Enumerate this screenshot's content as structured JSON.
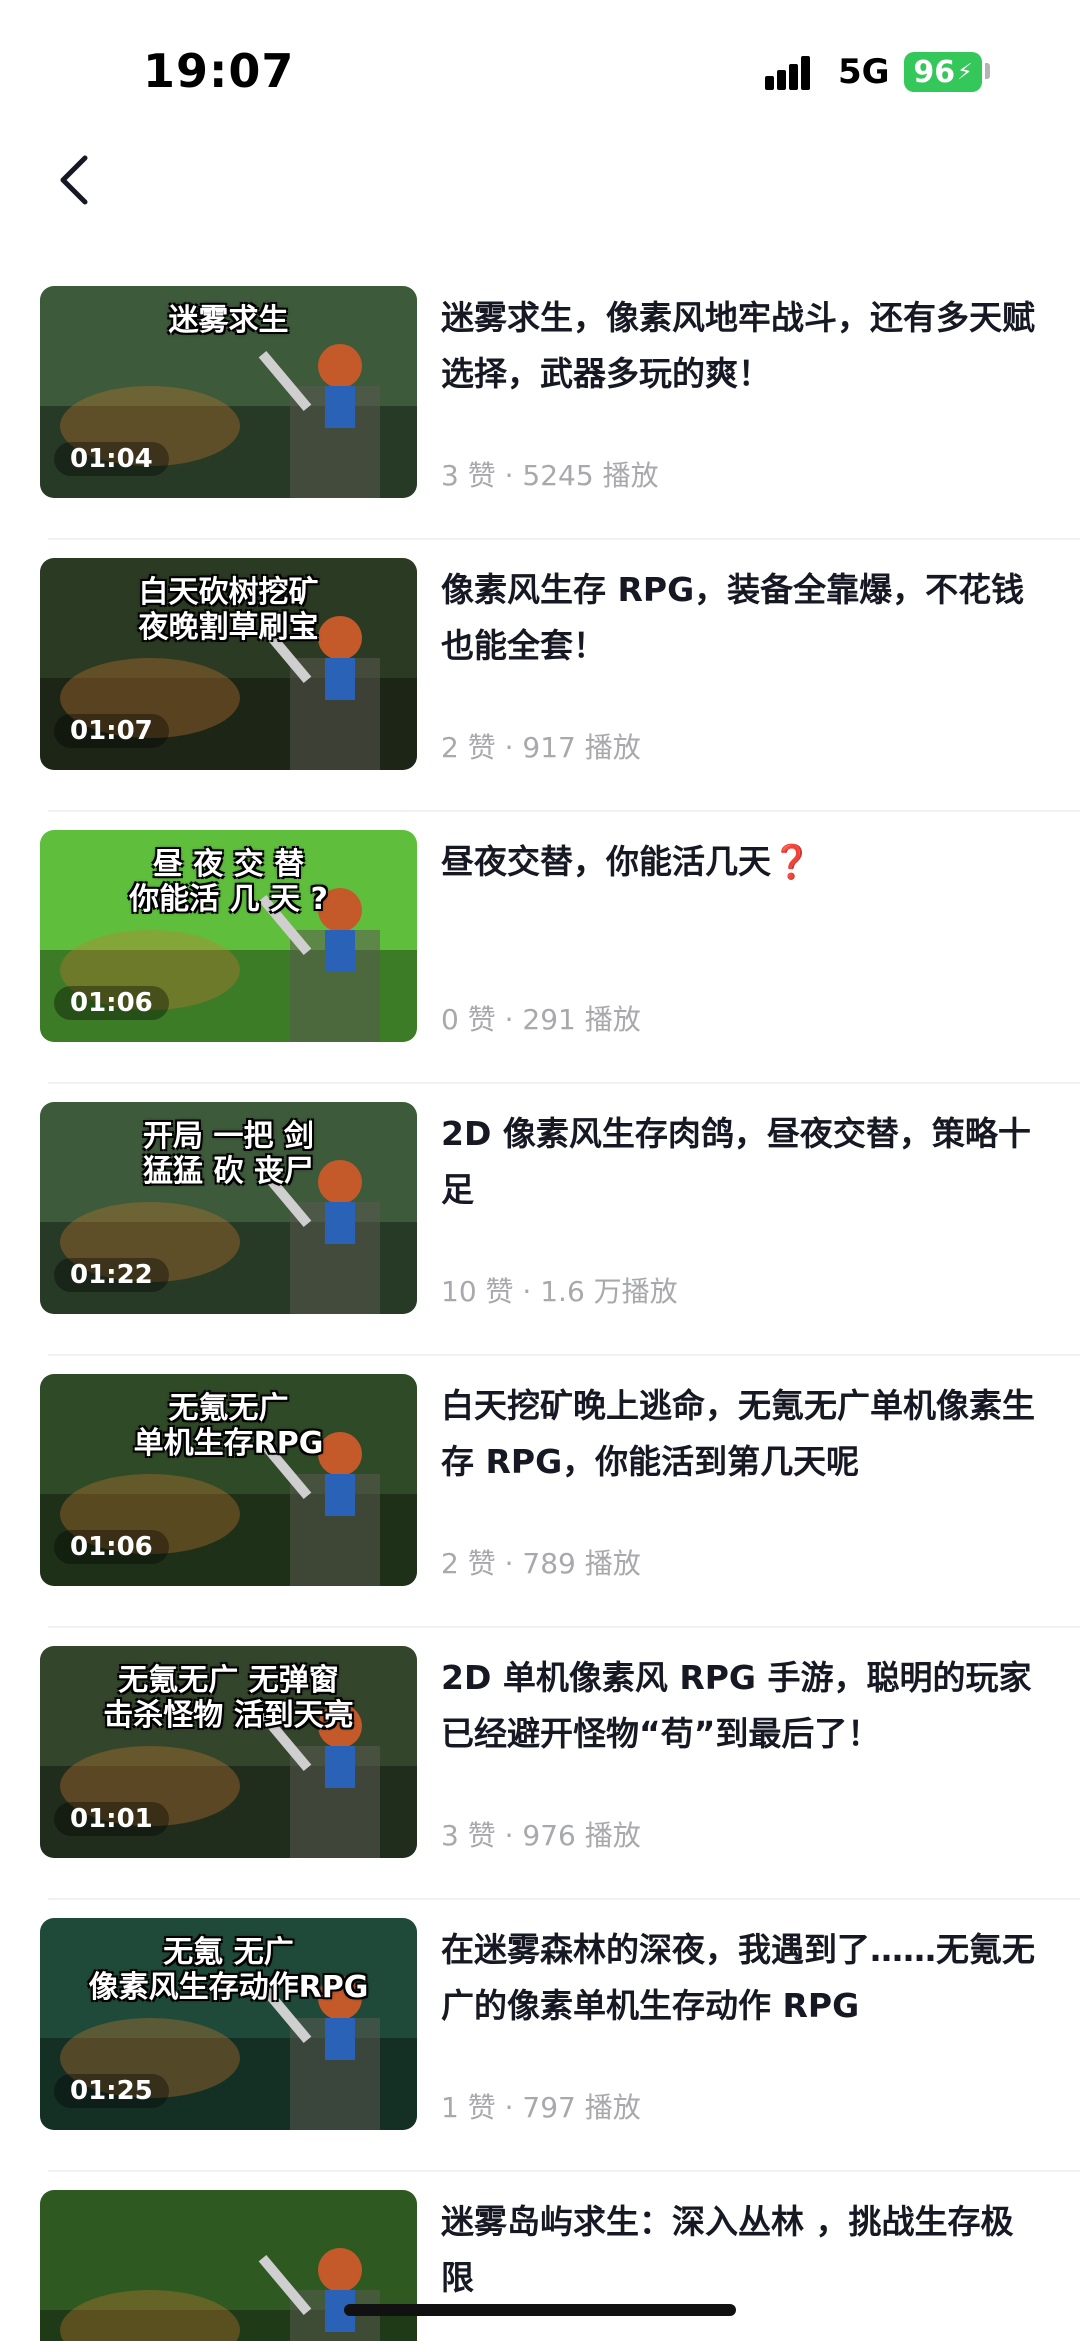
{
  "status_bar": {
    "time": "19:07",
    "network": "5G",
    "battery": "96"
  },
  "videos": [
    {
      "title": "迷雾求生，像素风地牢战斗，还有多天赋选择，武器多玩的爽！",
      "meta": "3 赞 · 5245 播放",
      "duration": "01:04",
      "thumb_text": "迷雾求生",
      "theme": "#3d5a3a"
    },
    {
      "title": "像素风生存 RPG，装备全靠爆，不花钱也能全套！",
      "meta": "2 赞 · 917 播放",
      "duration": "01:07",
      "thumb_text": "白天砍树挖矿\n夜晚割草刷宝",
      "theme": "#2b3a22"
    },
    {
      "title": "昼夜交替，你能活几天",
      "title_suffix": "❓",
      "meta": "0 赞 · 291 播放",
      "duration": "01:06",
      "thumb_text": "昼 夜 交 替\n你能活 几 天 ?",
      "theme": "#5fbf3d"
    },
    {
      "title": "2D 像素风生存肉鸽，昼夜交替，策略十足",
      "meta": "10 赞 · 1.6 万播放",
      "duration": "01:22",
      "thumb_text": "开局 一把 剑\n猛猛 砍 丧尸",
      "theme": "#3d5a3a"
    },
    {
      "title": "白天挖矿晚上逃命，无氪无广单机像素生存 RPG，你能活到第几天呢",
      "meta": "2 赞 · 789 播放",
      "duration": "01:06",
      "thumb_text": "无氪无广\n单机生存RPG",
      "theme": "#2f4a26"
    },
    {
      "title": "2D 单机像素风 RPG 手游，聪明的玩家已经避开怪物“苟”到最后了！",
      "meta": "3 赞 · 976 播放",
      "duration": "01:01",
      "thumb_text": "无氪无广 无弹窗\n击杀怪物 活到天亮",
      "theme": "#33452b"
    },
    {
      "title": "在迷雾森林的深夜，我遇到了……无氪无广的像素单机生存动作 RPG",
      "meta": "1 赞 · 797 播放",
      "duration": "01:25",
      "thumb_text": "无氪 无广\n像素风生存动作RPG",
      "theme": "#1f4a3a"
    },
    {
      "title": "迷雾岛屿求生：深入丛林 ，挑战生存极限",
      "meta": "",
      "duration": "",
      "thumb_text": "",
      "theme": "#2e5a22"
    }
  ]
}
